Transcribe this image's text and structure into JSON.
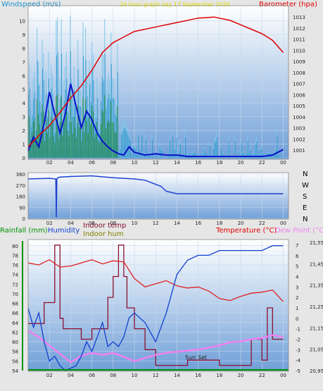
{
  "header": {
    "windspeed_label": "Windspeed (m/s)",
    "period_label": "24 hour graph day 17 September 2020",
    "barometer_label": "Barometer (hpa)"
  },
  "wind_dir_labels": [
    "N",
    "W",
    "S",
    "E",
    "N"
  ],
  "lower_header": {
    "rainfall_label": "Rainfall (mm)",
    "humidity_label": "Humidity",
    "indoor_temp_label": "Indoor temp",
    "indoor_hum_label": "Indoor hum",
    "temperature_label": "Temperature (°C)",
    "dewpoint_label": "Dew Point (°C)"
  },
  "sun_set_label": "Sun Set",
  "colors": {
    "windspeed": "#1e90c8",
    "gust": "#7fc4e8",
    "avg_wind": "#0a12c8",
    "green_wind": "#1a8a1a",
    "barometer": "#e00000",
    "direction": "#2040d0",
    "humidity": "#1040d0",
    "indoor_temp": "#8a1030",
    "indoor_hum": "#808000",
    "temperature": "#e02020",
    "dewpoint": "#f080f0",
    "rain": "#009000"
  },
  "chart_data": [
    {
      "type": "line",
      "name": "wind-barometer",
      "x_ticks": [
        "02",
        "04",
        "06",
        "08",
        "10",
        "12",
        "14",
        "16",
        "18",
        "20",
        "22",
        "00"
      ],
      "wind_y_ticks": [
        "0",
        "1",
        "2",
        "3",
        "4",
        "5",
        "6",
        "7",
        "8",
        "9",
        "10"
      ],
      "wind_ylim": [
        0,
        11
      ],
      "baro_y_ticks": [
        "1001",
        "1002",
        "1003",
        "1004",
        "1005",
        "1006",
        "1007",
        "1008",
        "1009",
        "1010",
        "1011",
        "1012",
        "1013"
      ],
      "baro_ylim": [
        1000.3,
        1013.9
      ],
      "barometer": {
        "x": [
          0,
          1,
          2,
          3,
          4,
          5,
          6,
          7,
          8,
          9,
          10,
          12,
          14,
          16,
          17.5,
          19,
          20,
          21,
          22,
          23,
          24
        ],
        "y": [
          1001.3,
          1002.3,
          1003.2,
          1004.4,
          1005.7,
          1006.8,
          1008.2,
          1009.8,
          1010.7,
          1011.2,
          1011.7,
          1012.1,
          1012.5,
          1012.9,
          1013.0,
          1012.7,
          1012.3,
          1011.9,
          1011.5,
          1010.9,
          1009.8
        ]
      },
      "avg_wind": {
        "x": [
          0,
          0.5,
          1,
          1.5,
          2,
          2.5,
          3,
          3.5,
          4,
          4.5,
          5,
          5.5,
          6,
          6.5,
          7,
          7.5,
          8,
          8.5,
          9,
          9.5,
          10,
          11,
          12,
          13,
          14,
          15,
          16,
          17,
          18,
          19,
          20,
          21,
          22,
          23,
          24
        ],
        "y": [
          0.5,
          1.5,
          0.8,
          2.5,
          4.8,
          3.2,
          1.8,
          3.2,
          5.4,
          3.8,
          2.2,
          3.4,
          2.8,
          1.8,
          1.2,
          0.8,
          0.5,
          0.3,
          0.2,
          0.8,
          0.4,
          0.2,
          0.3,
          0.2,
          0.2,
          0.1,
          0.1,
          0.1,
          0.1,
          0.1,
          0.1,
          0.1,
          0.1,
          0.2,
          0.6
        ]
      }
    },
    {
      "type": "line",
      "name": "wind-direction",
      "y_ticks": [
        "360",
        "270",
        "180",
        "90",
        "0"
      ],
      "ylim": [
        0,
        360
      ],
      "x": [
        0,
        2,
        2.6,
        2.65,
        2.7,
        2.8,
        3,
        4,
        6,
        8,
        10,
        11,
        12.5,
        13,
        14,
        24
      ],
      "y": [
        320,
        325,
        320,
        10,
        320,
        330,
        335,
        340,
        345,
        330,
        320,
        310,
        260,
        220,
        200,
        200
      ]
    },
    {
      "type": "line",
      "name": "temp-humidity",
      "humidity_ticks": [
        "54",
        "56",
        "58",
        "60",
        "62",
        "64",
        "66",
        "68",
        "70",
        "72",
        "74",
        "76",
        "78",
        "80"
      ],
      "humidity_ylim": [
        54,
        81
      ],
      "temp_ticks": [
        "-5",
        "-4",
        "-3",
        "-2",
        "-1",
        "0",
        "1",
        "2",
        "3",
        "4",
        "5",
        "6",
        "7"
      ],
      "temp_ylim": [
        -5,
        7.4
      ],
      "indoor_ticks": [
        "20,95",
        "21,05",
        "21,15",
        "21,25",
        "21,35",
        "21,45",
        "21,55"
      ],
      "humidity": {
        "x": [
          0,
          0.5,
          1,
          1.5,
          2,
          2.5,
          3,
          3.5,
          4,
          4.5,
          5,
          5.5,
          6,
          6.5,
          7,
          7.5,
          8,
          8.5,
          9,
          9.5,
          10,
          11,
          12,
          13,
          14,
          15,
          16,
          17,
          18,
          19,
          20,
          21,
          22,
          23,
          24
        ],
        "y": [
          67,
          63,
          66,
          60,
          56,
          57,
          55,
          54,
          54.5,
          55,
          57,
          60,
          58,
          61,
          64,
          59,
          60,
          59,
          61,
          65,
          66,
          64,
          60,
          66,
          74,
          77,
          78,
          78,
          79,
          79,
          79,
          79,
          79,
          80,
          80
        ]
      },
      "temperature": {
        "x": [
          0,
          1,
          2,
          3,
          4,
          5,
          6,
          7,
          8,
          9,
          10,
          11,
          12,
          13,
          14,
          15,
          16,
          17,
          18,
          19,
          20,
          21,
          22,
          23,
          24
        ],
        "y": [
          5.3,
          5.1,
          5.6,
          4.9,
          5.0,
          5.3,
          5.6,
          5.2,
          5.5,
          5.4,
          3.8,
          3.0,
          3.3,
          3.6,
          3.1,
          2.9,
          3.0,
          2.6,
          1.9,
          1.7,
          2.1,
          2.4,
          2.5,
          2.7,
          1.6
        ]
      },
      "dewpoint": {
        "x": [
          0,
          1,
          2,
          3,
          4,
          5,
          6,
          7,
          8,
          9,
          10,
          11,
          12,
          13,
          14,
          15,
          16,
          17,
          18,
          19,
          20,
          21,
          22,
          23,
          24
        ],
        "y": [
          -1.2,
          -1.8,
          -2.6,
          -3.4,
          -4.2,
          -3.6,
          -3.3,
          -3.5,
          -3.3,
          -3.7,
          -4.1,
          -3.8,
          -3.5,
          -3.3,
          -3.2,
          -3.1,
          -3.0,
          -2.8,
          -2.6,
          -2.3,
          -2.2,
          -2.0,
          -1.9,
          -1.6,
          -1.8
        ]
      },
      "indoor_temp": {
        "x": [
          0,
          1.5,
          1.5,
          2.5,
          2.5,
          3,
          3,
          3.3,
          3.3,
          5,
          5,
          6,
          6,
          7.5,
          7.5,
          8,
          8,
          8.5,
          8.5,
          9,
          9,
          9.3,
          9.3,
          10,
          10,
          11,
          11,
          12,
          12,
          15,
          15,
          18,
          18,
          21,
          21,
          22,
          22,
          22.5,
          22.5,
          23,
          23,
          24
        ],
        "y": [
          -0.5,
          -0.5,
          1.5,
          1.5,
          7.0,
          7.0,
          0,
          0,
          -1.0,
          -1.0,
          -2.0,
          -2.0,
          -1.0,
          -1.0,
          2.0,
          2.0,
          4.0,
          4.0,
          7.0,
          7.0,
          4.0,
          4.0,
          1.0,
          1.0,
          -1.0,
          -1.0,
          -3.0,
          -3.0,
          -4.5,
          -4.5,
          -4.0,
          -4.0,
          -4.5,
          -4.5,
          -2.0,
          -2.0,
          -4.0,
          -4.0,
          1.0,
          1.0,
          -2.0,
          -2.0
        ]
      },
      "rain": {
        "x": [
          0,
          24
        ],
        "y": [
          0,
          0
        ]
      }
    }
  ]
}
